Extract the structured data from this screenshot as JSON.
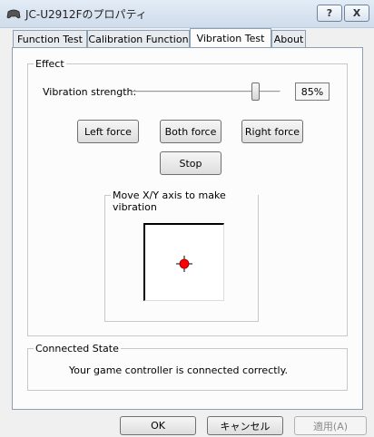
{
  "window": {
    "title": "JC-U2912Fのプロパティ",
    "help_label": "?",
    "close_label": "X"
  },
  "tabs": [
    {
      "label": "Function Test"
    },
    {
      "label": "Calibration Function"
    },
    {
      "label": "Vibration Test"
    },
    {
      "label": "About"
    }
  ],
  "effect": {
    "legend": "Effect",
    "strength_label": "Vibration strength:",
    "strength_value": "85%",
    "strength_fraction": 0.85,
    "left_force": "Left force",
    "both_force": "Both force",
    "right_force": "Right force",
    "stop": "Stop"
  },
  "axis": {
    "legend": "Move X/Y axis to make vibration",
    "cursor_color": "#ff0000"
  },
  "connected": {
    "legend": "Connected State",
    "message": "Your game controller is connected correctly."
  },
  "footer": {
    "ok": "OK",
    "cancel": "キャンセル",
    "apply": "適用(A)"
  }
}
